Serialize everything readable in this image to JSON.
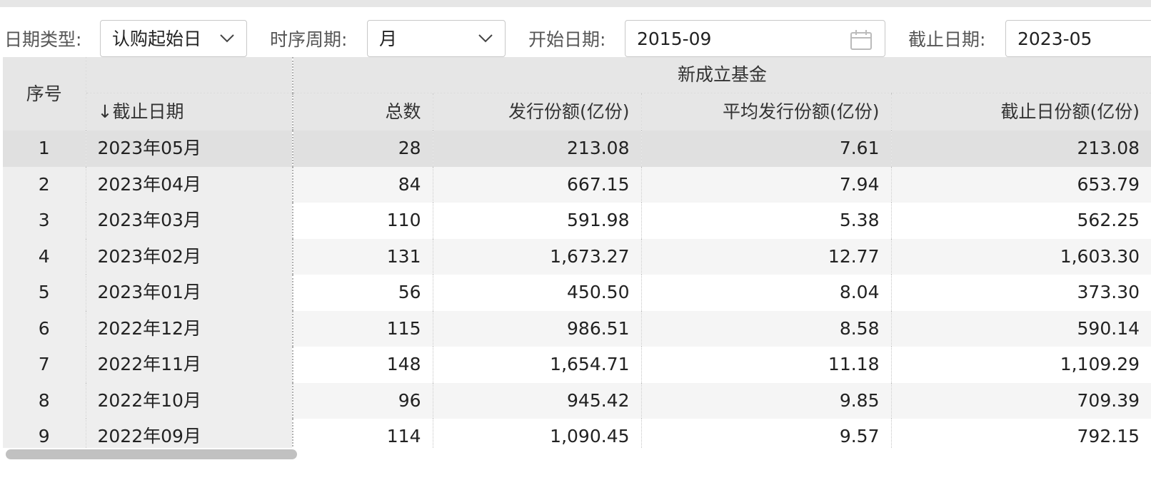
{
  "filters": {
    "date_type": {
      "label": "日期类型:",
      "value": "认购起始日"
    },
    "period": {
      "label": "时序周期:",
      "value": "月"
    },
    "start_date": {
      "label": "开始日期:",
      "value": "2015-09"
    },
    "end_date": {
      "label": "截止日期:",
      "value": "2023-05"
    }
  },
  "table": {
    "header_group": "新成立基金",
    "col_index": "序号",
    "col_date": "截止日期",
    "sort_arrow": "↓",
    "columns": [
      "总数",
      "发行份额(亿份)",
      "平均发行份额(亿份)",
      "截止日份额(亿份)"
    ],
    "rows": [
      {
        "idx": "1",
        "date": "2023年05月",
        "total": "28",
        "issued": "213.08",
        "avg": "7.61",
        "end": "213.08"
      },
      {
        "idx": "2",
        "date": "2023年04月",
        "total": "84",
        "issued": "667.15",
        "avg": "7.94",
        "end": "653.79"
      },
      {
        "idx": "3",
        "date": "2023年03月",
        "total": "110",
        "issued": "591.98",
        "avg": "5.38",
        "end": "562.25"
      },
      {
        "idx": "4",
        "date": "2023年02月",
        "total": "131",
        "issued": "1,673.27",
        "avg": "12.77",
        "end": "1,603.30"
      },
      {
        "idx": "5",
        "date": "2023年01月",
        "total": "56",
        "issued": "450.50",
        "avg": "8.04",
        "end": "373.30"
      },
      {
        "idx": "6",
        "date": "2022年12月",
        "total": "115",
        "issued": "986.51",
        "avg": "8.58",
        "end": "590.14"
      },
      {
        "idx": "7",
        "date": "2022年11月",
        "total": "148",
        "issued": "1,654.71",
        "avg": "11.18",
        "end": "1,109.29"
      },
      {
        "idx": "8",
        "date": "2022年10月",
        "total": "96",
        "issued": "945.42",
        "avg": "9.85",
        "end": "709.39"
      },
      {
        "idx": "9",
        "date": "2022年09月",
        "total": "114",
        "issued": "1,090.45",
        "avg": "9.57",
        "end": "792.15"
      }
    ]
  }
}
